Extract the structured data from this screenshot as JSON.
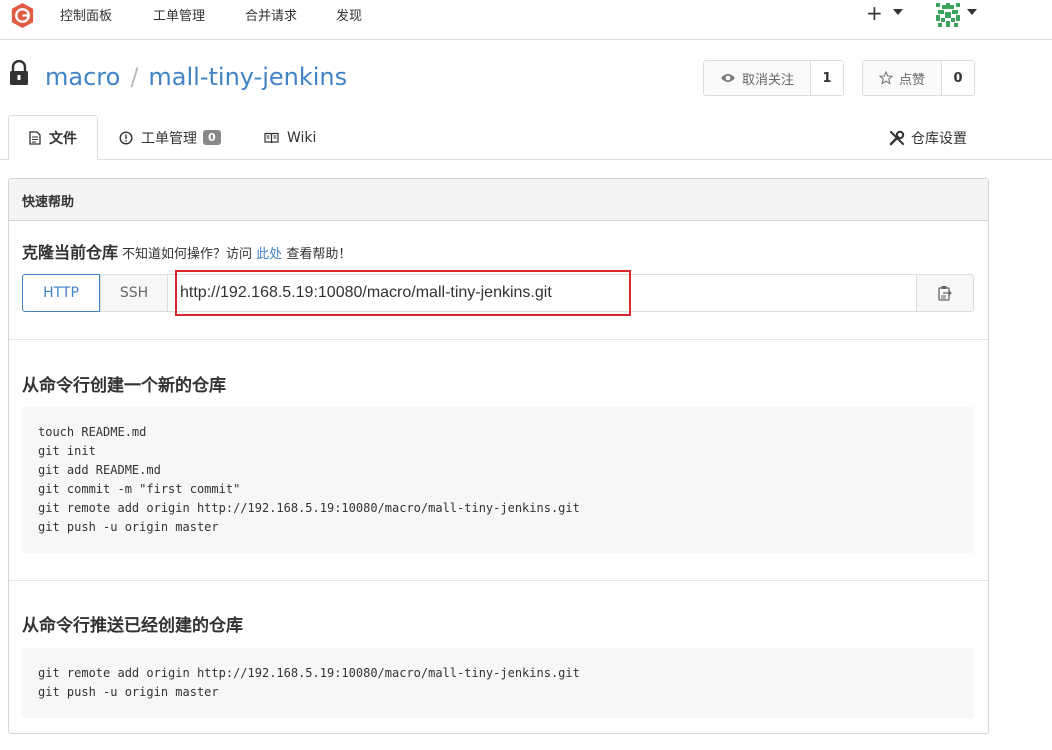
{
  "nav": {
    "items": [
      "控制面板",
      "工单管理",
      "合并请求",
      "发现"
    ]
  },
  "repo": {
    "owner": "macro",
    "separator": "/",
    "name": "mall-tiny-jenkins",
    "unwatch_label": "取消关注",
    "watch_count": "1",
    "star_label": "点赞",
    "star_count": "0"
  },
  "tabs": {
    "files": "文件",
    "issues": "工单管理",
    "issues_count": "0",
    "wiki": "Wiki",
    "settings": "仓库设置"
  },
  "quickstart": {
    "header": "快速帮助",
    "clone_title": "克隆当前仓库",
    "hint_prefix": "不知道如何操作？访问",
    "hint_link": "此处",
    "hint_suffix": "查看帮助！",
    "http_label": "HTTP",
    "ssh_label": "SSH",
    "clone_url": "http://192.168.5.19:10080/macro/mall-tiny-jenkins.git",
    "new_repo_title": "从命令行创建一个新的仓库",
    "new_repo_code": "touch README.md\ngit init\ngit add README.md\ngit commit -m \"first commit\"\ngit remote add origin http://192.168.5.19:10080/macro/mall-tiny-jenkins.git\ngit push -u origin master",
    "push_repo_title": "从命令行推送已经创建的仓库",
    "push_repo_code": "git remote add origin http://192.168.5.19:10080/macro/mall-tiny-jenkins.git\ngit push -u origin master"
  },
  "colors": {
    "link": "#4183c4",
    "highlight_border": "#d9282d",
    "logo": "#e05d44"
  },
  "icons": {
    "logo": "gogs-logo-icon",
    "plus": "plus-icon",
    "lock": "lock-icon",
    "eye": "eye-icon",
    "star": "star-icon",
    "file": "file-text-icon",
    "issue": "issue-opened-icon",
    "wiki": "book-icon",
    "settings": "tools-icon",
    "copy": "clipboard-icon"
  }
}
